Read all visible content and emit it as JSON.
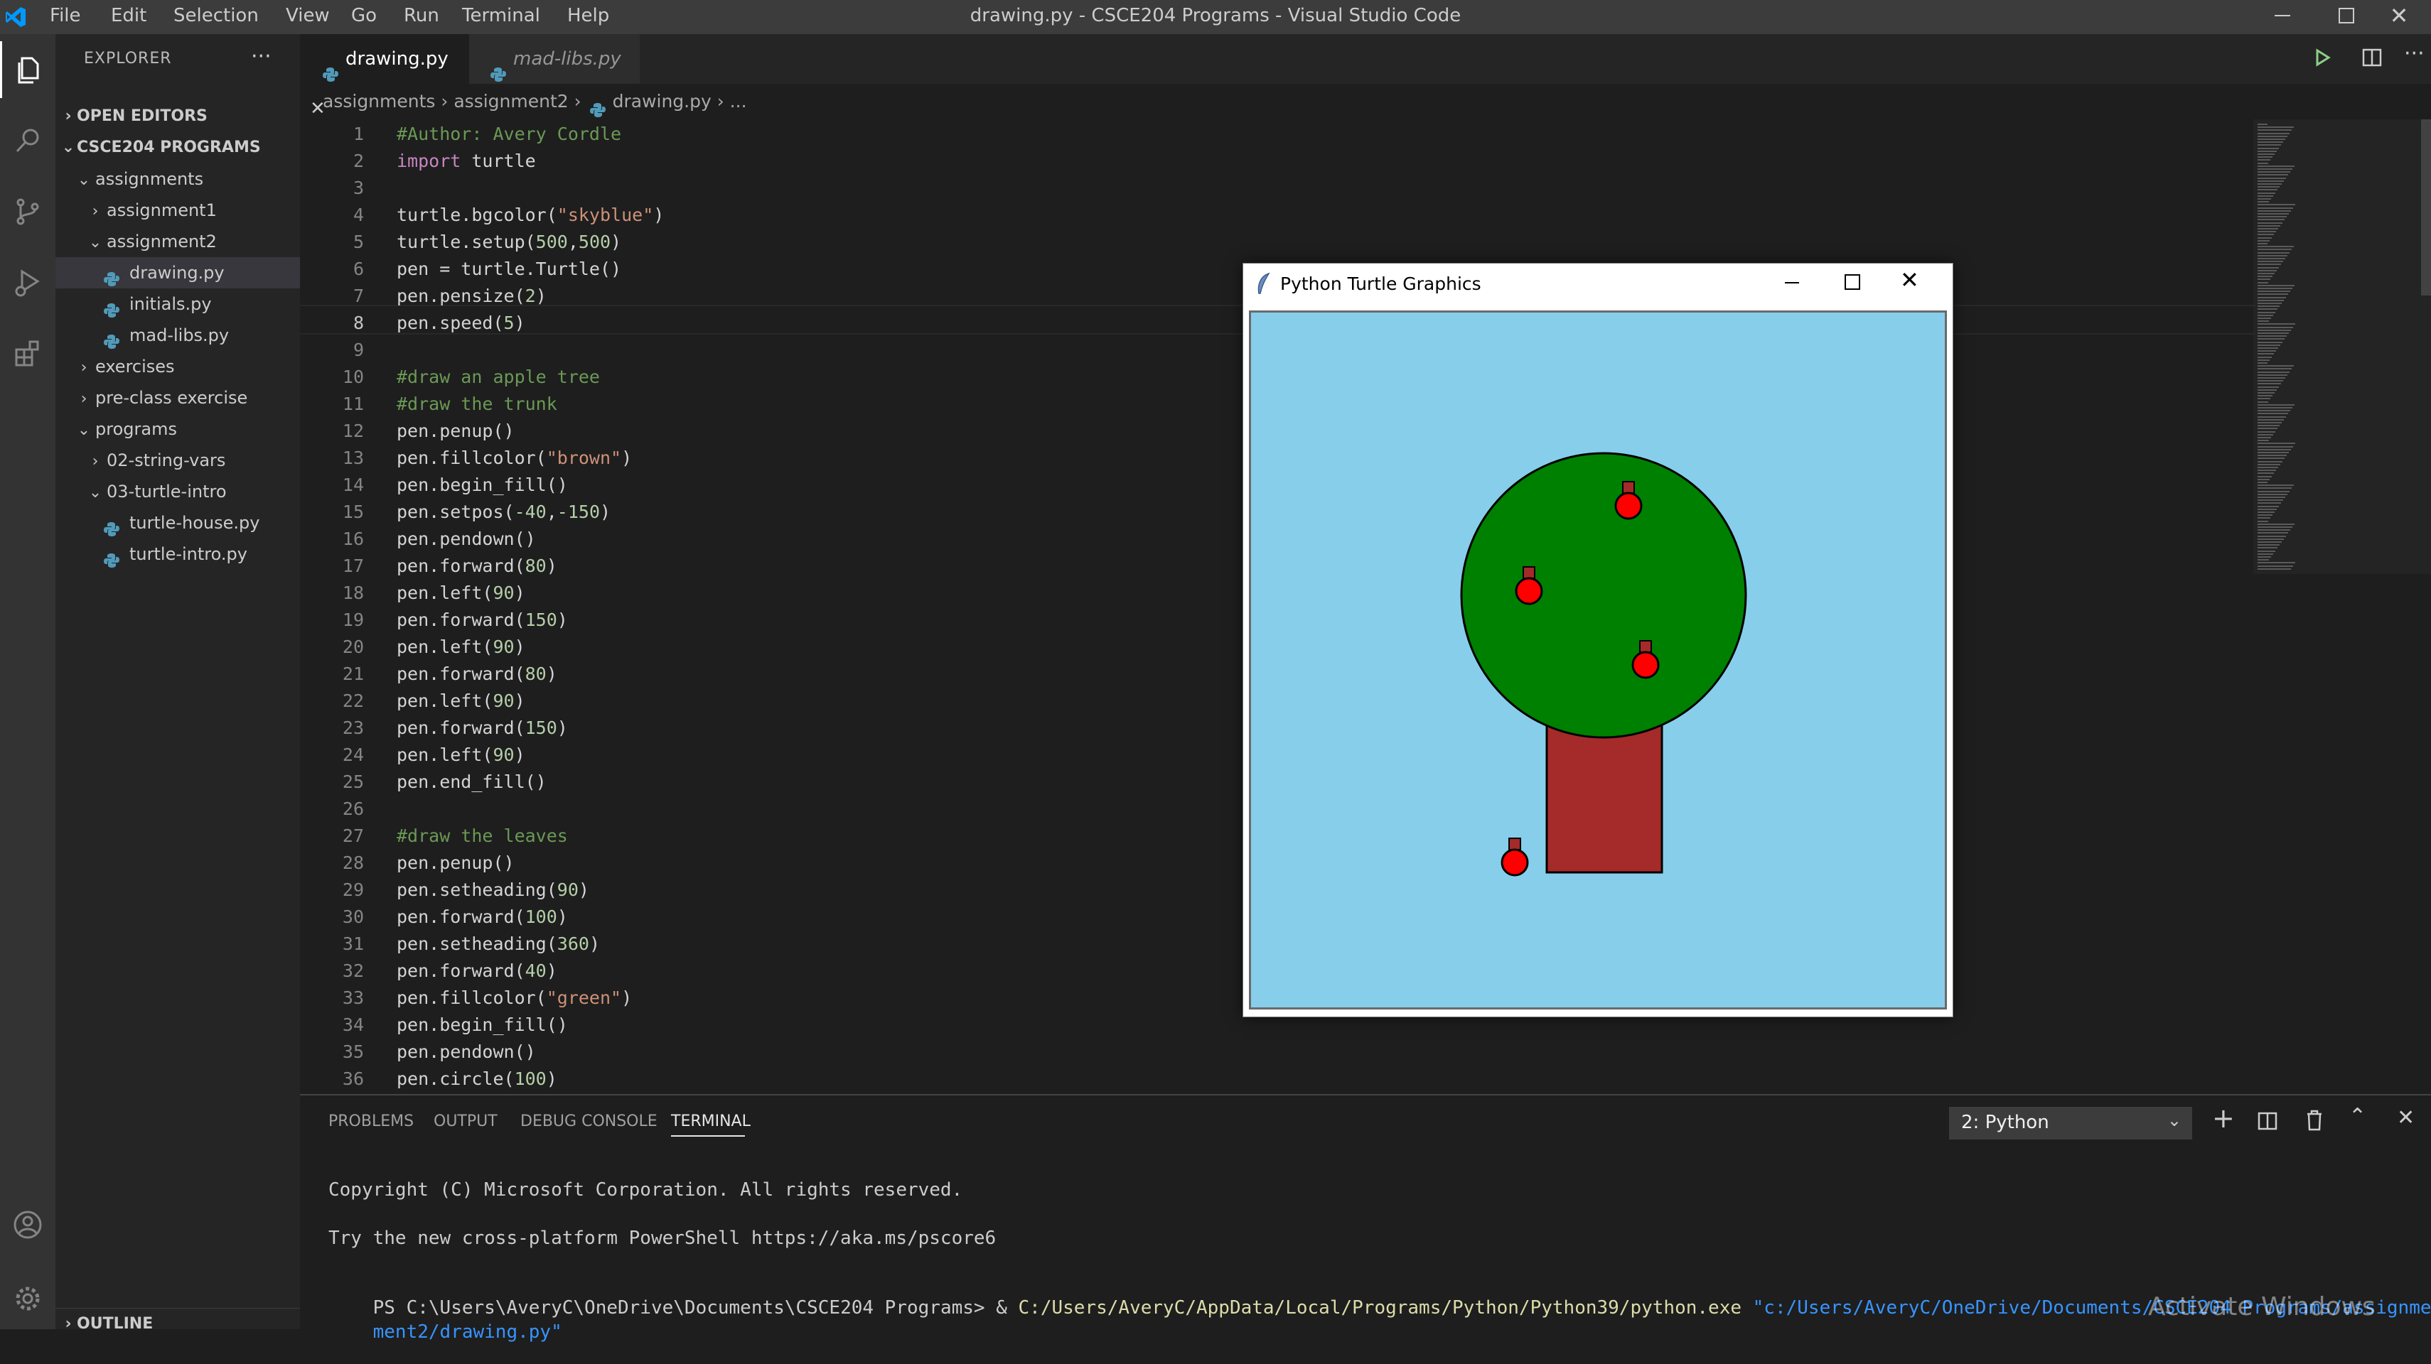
{
  "window": {
    "title": "drawing.py - CSCE204 Programs - Visual Studio Code",
    "menu": [
      "File",
      "Edit",
      "Selection",
      "View",
      "Go",
      "Run",
      "Terminal",
      "Help"
    ]
  },
  "activity_bar": {
    "icons": [
      "files-icon",
      "search-icon",
      "source-control-icon",
      "run-debug-icon",
      "extensions-icon",
      "account-icon",
      "settings-gear-icon"
    ]
  },
  "sidebar": {
    "header": "EXPLORER",
    "open_editors": "OPEN EDITORS",
    "project": "CSCE204 PROGRAMS",
    "outline": "OUTLINE",
    "tree": [
      {
        "label": "assignments",
        "level": 0,
        "type": "folder",
        "open": true
      },
      {
        "label": "assignment1",
        "level": 1,
        "type": "folder",
        "open": false
      },
      {
        "label": "assignment2",
        "level": 1,
        "type": "folder",
        "open": true
      },
      {
        "label": "drawing.py",
        "level": 2,
        "type": "file",
        "selected": true
      },
      {
        "label": "initials.py",
        "level": 2,
        "type": "file"
      },
      {
        "label": "mad-libs.py",
        "level": 2,
        "type": "file"
      },
      {
        "label": "exercises",
        "level": 0,
        "type": "folder",
        "open": false
      },
      {
        "label": "pre-class exercise",
        "level": 0,
        "type": "folder",
        "open": false
      },
      {
        "label": "programs",
        "level": 0,
        "type": "folder",
        "open": true
      },
      {
        "label": "02-string-vars",
        "level": 1,
        "type": "folder",
        "open": false
      },
      {
        "label": "03-turtle-intro",
        "level": 1,
        "type": "folder",
        "open": true
      },
      {
        "label": "turtle-house.py",
        "level": 2,
        "type": "file"
      },
      {
        "label": "turtle-intro.py",
        "level": 2,
        "type": "file"
      }
    ]
  },
  "tabs": [
    {
      "label": "drawing.py",
      "active": true
    },
    {
      "label": "mad-libs.py",
      "active": false
    }
  ],
  "breadcrumb": [
    "assignments",
    "assignment2",
    "drawing.py",
    "..."
  ],
  "editor": {
    "current_line": 8,
    "lines": [
      [
        {
          "t": "#Author: Avery Cordle",
          "c": "com"
        }
      ],
      [
        {
          "t": "import",
          "c": "kw"
        },
        {
          "t": " turtle",
          "c": "id"
        }
      ],
      [],
      [
        {
          "t": "turtle.bgcolor(",
          "c": "id"
        },
        {
          "t": "\"skyblue\"",
          "c": "str"
        },
        {
          "t": ")",
          "c": "id"
        }
      ],
      [
        {
          "t": "turtle.setup(",
          "c": "id"
        },
        {
          "t": "500",
          "c": "num"
        },
        {
          "t": ",",
          "c": "id"
        },
        {
          "t": "500",
          "c": "num"
        },
        {
          "t": ")",
          "c": "id"
        }
      ],
      [
        {
          "t": "pen = turtle.Turtle()",
          "c": "id"
        }
      ],
      [
        {
          "t": "pen.pensize(",
          "c": "id"
        },
        {
          "t": "2",
          "c": "num"
        },
        {
          "t": ")",
          "c": "id"
        }
      ],
      [
        {
          "t": "pen.speed(",
          "c": "id"
        },
        {
          "t": "5",
          "c": "num"
        },
        {
          "t": ")",
          "c": "id"
        }
      ],
      [],
      [
        {
          "t": "#draw an apple tree",
          "c": "com"
        }
      ],
      [
        {
          "t": "#draw the trunk",
          "c": "com"
        }
      ],
      [
        {
          "t": "pen.penup()",
          "c": "id"
        }
      ],
      [
        {
          "t": "pen.fillcolor(",
          "c": "id"
        },
        {
          "t": "\"brown\"",
          "c": "str"
        },
        {
          "t": ")",
          "c": "id"
        }
      ],
      [
        {
          "t": "pen.begin_fill()",
          "c": "id"
        }
      ],
      [
        {
          "t": "pen.setpos(",
          "c": "id"
        },
        {
          "t": "-40",
          "c": "num"
        },
        {
          "t": ",",
          "c": "id"
        },
        {
          "t": "-150",
          "c": "num"
        },
        {
          "t": ")",
          "c": "id"
        }
      ],
      [
        {
          "t": "pen.pendown()",
          "c": "id"
        }
      ],
      [
        {
          "t": "pen.forward(",
          "c": "id"
        },
        {
          "t": "80",
          "c": "num"
        },
        {
          "t": ")",
          "c": "id"
        }
      ],
      [
        {
          "t": "pen.left(",
          "c": "id"
        },
        {
          "t": "90",
          "c": "num"
        },
        {
          "t": ")",
          "c": "id"
        }
      ],
      [
        {
          "t": "pen.forward(",
          "c": "id"
        },
        {
          "t": "150",
          "c": "num"
        },
        {
          "t": ")",
          "c": "id"
        }
      ],
      [
        {
          "t": "pen.left(",
          "c": "id"
        },
        {
          "t": "90",
          "c": "num"
        },
        {
          "t": ")",
          "c": "id"
        }
      ],
      [
        {
          "t": "pen.forward(",
          "c": "id"
        },
        {
          "t": "80",
          "c": "num"
        },
        {
          "t": ")",
          "c": "id"
        }
      ],
      [
        {
          "t": "pen.left(",
          "c": "id"
        },
        {
          "t": "90",
          "c": "num"
        },
        {
          "t": ")",
          "c": "id"
        }
      ],
      [
        {
          "t": "pen.forward(",
          "c": "id"
        },
        {
          "t": "150",
          "c": "num"
        },
        {
          "t": ")",
          "c": "id"
        }
      ],
      [
        {
          "t": "pen.left(",
          "c": "id"
        },
        {
          "t": "90",
          "c": "num"
        },
        {
          "t": ")",
          "c": "id"
        }
      ],
      [
        {
          "t": "pen.end_fill()",
          "c": "id"
        }
      ],
      [],
      [
        {
          "t": "#draw the leaves",
          "c": "com"
        }
      ],
      [
        {
          "t": "pen.penup()",
          "c": "id"
        }
      ],
      [
        {
          "t": "pen.setheading(",
          "c": "id"
        },
        {
          "t": "90",
          "c": "num"
        },
        {
          "t": ")",
          "c": "id"
        }
      ],
      [
        {
          "t": "pen.forward(",
          "c": "id"
        },
        {
          "t": "100",
          "c": "num"
        },
        {
          "t": ")",
          "c": "id"
        }
      ],
      [
        {
          "t": "pen.setheading(",
          "c": "id"
        },
        {
          "t": "360",
          "c": "num"
        },
        {
          "t": ")",
          "c": "id"
        }
      ],
      [
        {
          "t": "pen.forward(",
          "c": "id"
        },
        {
          "t": "40",
          "c": "num"
        },
        {
          "t": ")",
          "c": "id"
        }
      ],
      [
        {
          "t": "pen.fillcolor(",
          "c": "id"
        },
        {
          "t": "\"green\"",
          "c": "str"
        },
        {
          "t": ")",
          "c": "id"
        }
      ],
      [
        {
          "t": "pen.begin_fill()",
          "c": "id"
        }
      ],
      [
        {
          "t": "pen.pendown()",
          "c": "id"
        }
      ],
      [
        {
          "t": "pen.circle(",
          "c": "id"
        },
        {
          "t": "100",
          "c": "num"
        },
        {
          "t": ")",
          "c": "id"
        }
      ]
    ]
  },
  "panel": {
    "tabs": [
      "PROBLEMS",
      "OUTPUT",
      "DEBUG CONSOLE",
      "TERMINAL"
    ],
    "active_tab": "TERMINAL",
    "terminal_select": "2: Python",
    "terminal_lines": [
      "Copyright (C) Microsoft Corporation. All rights reserved.",
      "",
      "Try the new cross-platform PowerShell https://aka.ms/pscore6",
      ""
    ],
    "prompt": "PS C:\\Users\\AveryC\\OneDrive\\Documents\\CSCE204 Programs> & ",
    "exe": "C:/Users/AveryC/AppData/Local/Programs/Python/Python39/python.exe",
    "arg_part1": " \"c:/Users/AveryC/OneDrive/Documents/CSCE204 Programs/assignments/assign",
    "arg_part2": "ment2/drawing.py\""
  },
  "turtle_window": {
    "title": "Python Turtle Graphics",
    "background": "#87ceeb",
    "trunk_color": "#a52a2a",
    "leaves_color": "#008000",
    "apple_color": "#ff0000"
  },
  "watermark": "Activate Windows",
  "colors": {
    "accent": "#007acc",
    "keyword": "#c586c0",
    "string": "#ce9178",
    "number": "#b5cea8",
    "comment": "#6a9955",
    "identifier": "#d4d4d4"
  }
}
